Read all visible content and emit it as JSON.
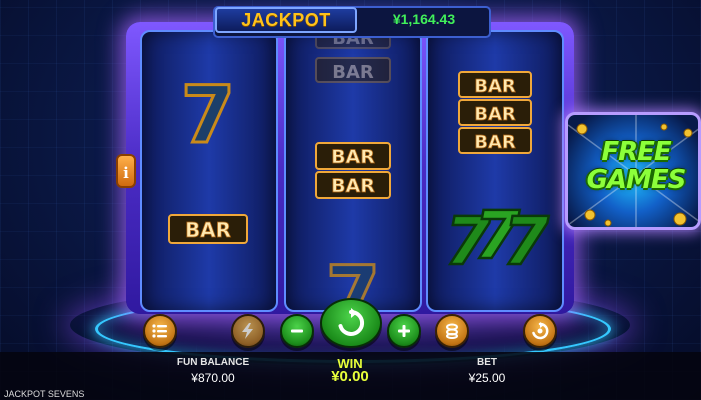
{
  "jackpot": {
    "label": "JACKPOT",
    "amount": "¥1,164.43"
  },
  "info_button": {
    "label": "i"
  },
  "symbols": {
    "bar": "BAR",
    "seven": "7"
  },
  "free_games": {
    "line1": "FREE",
    "line2": "GAMES"
  },
  "balance": {
    "label": "FUN BALANCE",
    "value": "¥870.00"
  },
  "win": {
    "label": "WIN",
    "value": "¥0.00"
  },
  "bet": {
    "label": "BET",
    "value": "¥25.00"
  },
  "game_title": "JACKPOT SEVENS",
  "controls": [
    "menu-icon",
    "turbo-icon",
    "minus-icon",
    "spin-icon",
    "plus-icon",
    "coins-icon",
    "autoplay-icon"
  ],
  "colors": {
    "accent_green": "#41f05a",
    "jackpot_gold": "#ffc21a",
    "win_yellow": "#e8ff3a"
  }
}
